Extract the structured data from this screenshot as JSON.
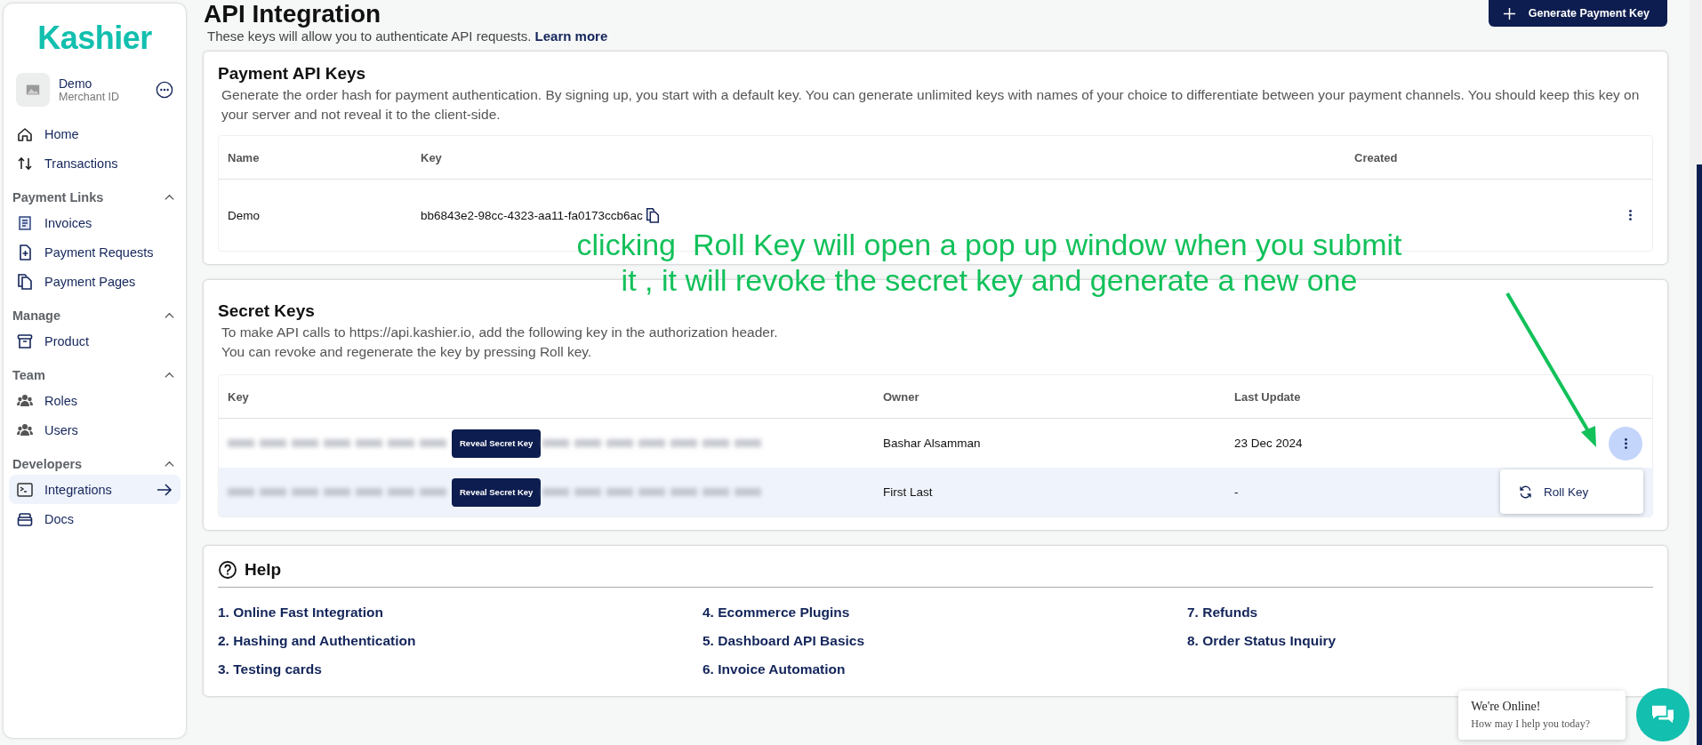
{
  "sidebar": {
    "logo": "Kashier",
    "account": {
      "name": "Demo",
      "subtitle": "Merchant ID"
    },
    "items": [
      {
        "label": "Home",
        "selected": false
      },
      {
        "label": "Transactions",
        "selected": false
      }
    ],
    "sections": [
      {
        "title": "Payment Links",
        "expanded": true,
        "items": [
          {
            "label": "Invoices",
            "selected": false
          },
          {
            "label": "Payment Requests",
            "selected": false
          },
          {
            "label": "Payment Pages",
            "selected": false
          }
        ]
      },
      {
        "title": "Manage",
        "expanded": true,
        "items": [
          {
            "label": "Product",
            "selected": false
          }
        ]
      },
      {
        "title": "Team",
        "expanded": true,
        "items": [
          {
            "label": "Roles",
            "selected": false
          },
          {
            "label": "Users",
            "selected": false
          }
        ]
      },
      {
        "title": "Developers",
        "expanded": true,
        "items": [
          {
            "label": "Integrations",
            "selected": true
          },
          {
            "label": "Docs",
            "selected": false
          }
        ]
      }
    ]
  },
  "header": {
    "title": "API Integration",
    "subtitle": "These keys will allow you to authenticate API requests.",
    "link": "Learn more",
    "button": "Generate Payment Key"
  },
  "payment_keys": {
    "title": "Payment API Keys",
    "description": "Generate the order hash for payment authentication. By signing up, you start with a default key. You can generate unlimited keys with names of your choice to differentiate between your payment channels. You should keep this key on your server and not reveal it to the client-side.",
    "columns": [
      "Name",
      "Key",
      "Created"
    ],
    "rows": [
      {
        "name": "Demo",
        "key": "bb6843e2-98cc-4323-aa11-fa0173ccb6ac"
      }
    ]
  },
  "secret_keys": {
    "title": "Secret Keys",
    "description_lines": [
      "To make API calls to https://api.kashier.io, add the following key in the authorization header.",
      "You can revoke and regenerate the key by pressing Roll key."
    ],
    "columns": [
      "Key",
      "Owner",
      "Last Update"
    ],
    "rows": [
      {
        "reveal": "Reveal Secret Key",
        "owner": "Bashar Alsamman",
        "updated": "23 Dec 2024",
        "selected": false,
        "menu_open": true
      },
      {
        "reveal": "Reveal Secret Key",
        "owner": "First Last",
        "updated": "-",
        "selected": true,
        "menu_open": false
      }
    ],
    "menu": {
      "items": [
        "Roll Key"
      ]
    }
  },
  "annotation": {
    "lines": [
      "clicking  Roll Key will open a pop up window when you submit",
      "it , it will revoke the secret key and generate a new one"
    ]
  },
  "help": {
    "title": "Help",
    "links": [
      "1. Online Fast Integration",
      "2. Hashing and Authentication",
      "3. Testing cards",
      "4. Ecommerce Plugins",
      "5. Dashboard API Basics",
      "6. Invoice Automation",
      "7. Refunds",
      "8. Order Status Inquiry"
    ]
  },
  "chat": {
    "title": "We're Online!",
    "subtitle": "How may I help you today?"
  }
}
